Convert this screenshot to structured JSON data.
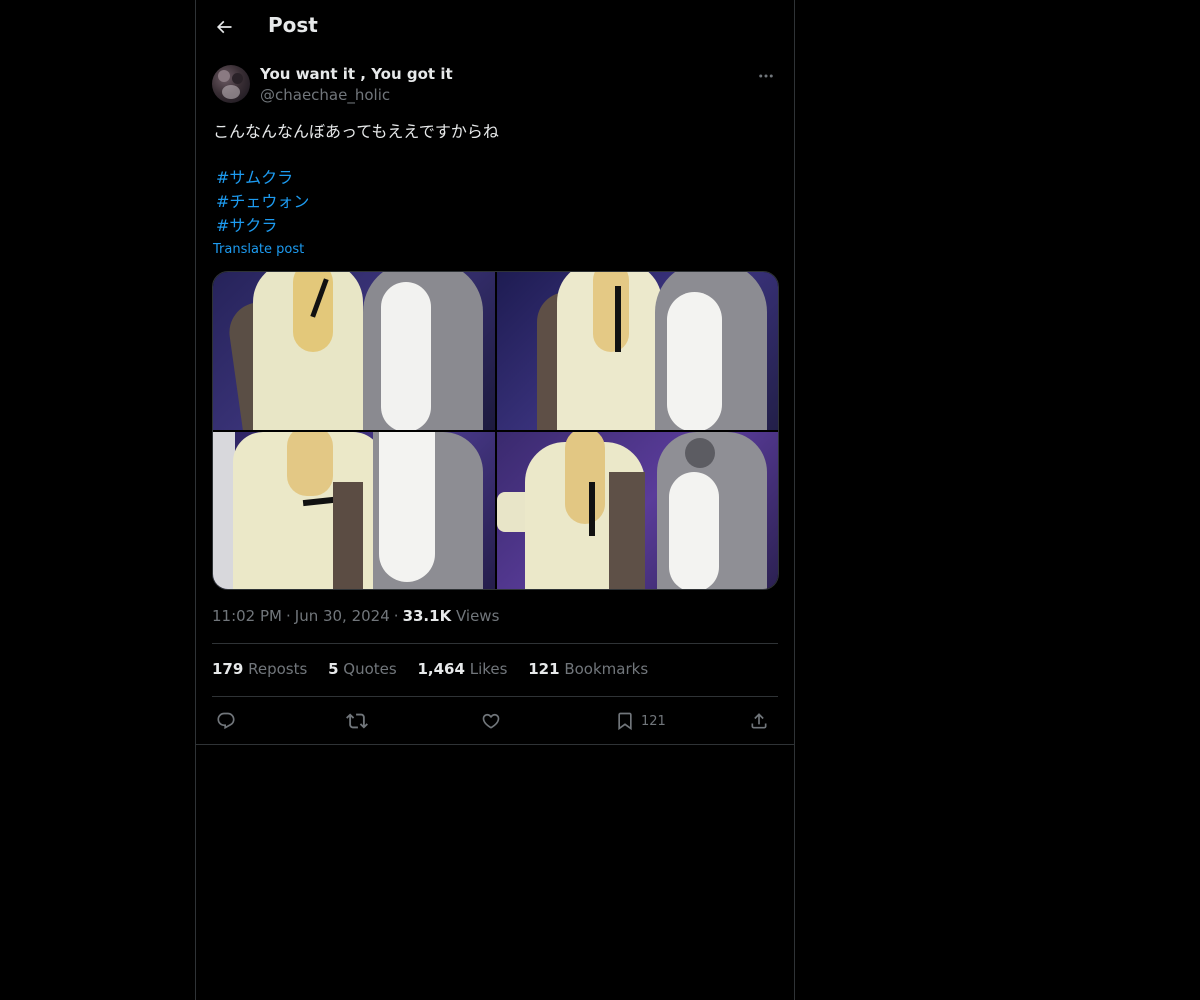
{
  "header": {
    "title": "Post"
  },
  "author": {
    "display_name": "You want it , You got it",
    "handle": "@chaechae_holic"
  },
  "post": {
    "text": "こんなんなんぼあってもええですからね",
    "hashtags": [
      "#サムクラ",
      "#チェウォン",
      "#サクラ"
    ],
    "translate_label": "Translate post",
    "media_count": 4
  },
  "meta": {
    "time": "11:02 PM",
    "date": "Jun 30, 2024",
    "views_count": "33.1K",
    "views_label": "Views"
  },
  "stats": {
    "reposts": {
      "count": "179",
      "label": "Reposts"
    },
    "quotes": {
      "count": "5",
      "label": "Quotes"
    },
    "likes": {
      "count": "1,464",
      "label": "Likes"
    },
    "bookmarks": {
      "count": "121",
      "label": "Bookmarks"
    }
  },
  "actions": {
    "icons": [
      "reply-icon",
      "repost-icon",
      "like-icon",
      "bookmark-icon",
      "share-icon"
    ],
    "bookmark_count": "121"
  },
  "colors": {
    "background": "#000000",
    "text": "#e7e9ea",
    "muted": "#71767b",
    "accent": "#1d9bf0",
    "border": "#2f3336"
  }
}
